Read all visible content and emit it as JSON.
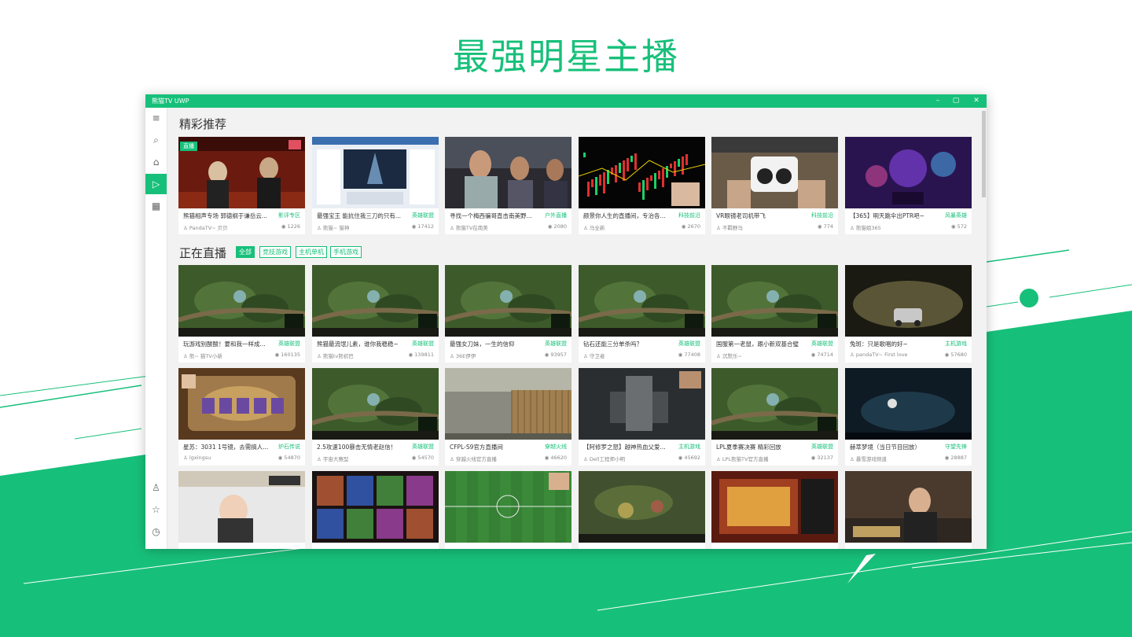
{
  "headline": "最强明星主播",
  "colors": {
    "accent": "#17c07a",
    "text": "#333333",
    "muted": "#888888"
  },
  "window": {
    "title": "熊猫TV UWP",
    "controls": {
      "minimize": "–",
      "maximize": "▢",
      "close": "✕"
    }
  },
  "sidebar": {
    "top": [
      {
        "icon": "menu-icon",
        "glyph": "≡"
      },
      {
        "icon": "search-icon",
        "glyph": "⌕"
      },
      {
        "icon": "home-icon",
        "glyph": "⌂"
      },
      {
        "icon": "play-icon",
        "glyph": "▷",
        "active": true
      },
      {
        "icon": "grid-icon",
        "glyph": "▦"
      }
    ],
    "bottom": [
      {
        "icon": "user-icon",
        "glyph": "♙"
      },
      {
        "icon": "star-icon",
        "glyph": "☆"
      },
      {
        "icon": "clock-icon",
        "glyph": "◷"
      },
      {
        "icon": "settings-icon",
        "glyph": "⚙"
      }
    ]
  },
  "featured": {
    "title": "精彩推荐",
    "cards": [
      {
        "title": "熊猫相声专场 郭德纲于谦岳云...",
        "category": "影评专区",
        "owner": "PandaTV~ 贝贝",
        "viewers": "1226",
        "badge": "直播",
        "scene": "stage"
      },
      {
        "title": "最强宝王 能抗住我三刀的只有...",
        "category": "英雄联盟",
        "owner": "熊猫~ 猫神",
        "viewers": "17412",
        "scene": "browser"
      },
      {
        "title": "寻找一个梅西骗哥直击南美野...",
        "category": "户外直播",
        "owner": "熊猫TV在南美",
        "viewers": "2080",
        "scene": "people"
      },
      {
        "title": "颜景你人生的直播间，专治各...",
        "category": "科技前沿",
        "owner": "马全新",
        "viewers": "2670",
        "scene": "stock"
      },
      {
        "title": "VR眼镜老司机带飞",
        "category": "科技前沿",
        "owner": "不羁野马",
        "viewers": "774",
        "scene": "vr"
      },
      {
        "title": "【365】明天跳伞出PTR吧~",
        "category": "风暴英雄",
        "owner": "熊猫姐365",
        "viewers": "572",
        "scene": "purple"
      }
    ]
  },
  "live": {
    "title": "正在直播",
    "chips": [
      "全部",
      "竞技游戏",
      "主机单机",
      "手机游戏"
    ],
    "cards": [
      {
        "title": "玩游戏别酸酸！要和我一样成...",
        "category": "英雄联盟",
        "owner": "熊~ 猫TV小新",
        "viewers": "160135",
        "scene": "moba"
      },
      {
        "title": "熊猫最流氓儿素，谁你我稳稳~",
        "category": "英雄联盟",
        "owner": "熊猫tv熊初巴",
        "viewers": "139811",
        "scene": "moba"
      },
      {
        "title": "最强女刀妹，一生的信仰",
        "category": "英雄联盟",
        "owner": "36E伊伊",
        "viewers": "93957",
        "scene": "moba"
      },
      {
        "title": "钻石还能三分单杀吗？",
        "category": "英雄联盟",
        "owner": "守卫者",
        "viewers": "77408",
        "scene": "moba"
      },
      {
        "title": "国服第一老鼠，跟小新双基合璧",
        "category": "英雄联盟",
        "owner": "沉默乐~",
        "viewers": "74714",
        "scene": "moba"
      },
      {
        "title": "兔斑：只是歌唱的好~",
        "category": "主机游戏",
        "owner": "pandaTV~ First love",
        "viewers": "57680",
        "scene": "car"
      },
      {
        "title": "星苏：3031 1号镜，去需搞人...",
        "category": "炉石传说",
        "owner": "lgxingsu",
        "viewers": "54870",
        "scene": "hearth"
      },
      {
        "title": "2.5攻速100暴击无情老赵信！",
        "category": "英雄联盟",
        "owner": "宇宙大赛型",
        "viewers": "54570",
        "scene": "moba"
      },
      {
        "title": "CFPL-S9官方直播间",
        "category": "穿越火线",
        "owner": "穿越火线官方直播",
        "viewers": "46620",
        "scene": "fps"
      },
      {
        "title": "【阿修罗之怒】越神热血父爱...",
        "category": "主机游戏",
        "owner": "Dell工程师小明",
        "viewers": "45692",
        "scene": "mech"
      },
      {
        "title": "LPL夏季赛决赛 精彩回放",
        "category": "英雄联盟",
        "owner": "LPL熊猫TV官方直播",
        "viewers": "32137",
        "scene": "moba"
      },
      {
        "title": "赫萃梦境（当日节目回放）",
        "category": "守望先锋",
        "owner": "暴雪游戏频道",
        "viewers": "28887",
        "scene": "dark"
      },
      {
        "title": "",
        "category": "",
        "owner": "",
        "viewers": "",
        "scene": "webcam"
      },
      {
        "title": "",
        "category": "",
        "owner": "",
        "viewers": "",
        "scene": "cards"
      },
      {
        "title": "",
        "category": "",
        "owner": "",
        "viewers": "",
        "scene": "soccer"
      },
      {
        "title": "",
        "category": "",
        "owner": "",
        "viewers": "",
        "scene": "moba2"
      },
      {
        "title": "",
        "category": "",
        "owner": "",
        "viewers": "",
        "scene": "slot"
      },
      {
        "title": "",
        "category": "",
        "owner": "",
        "viewers": "",
        "scene": "talk"
      }
    ]
  }
}
